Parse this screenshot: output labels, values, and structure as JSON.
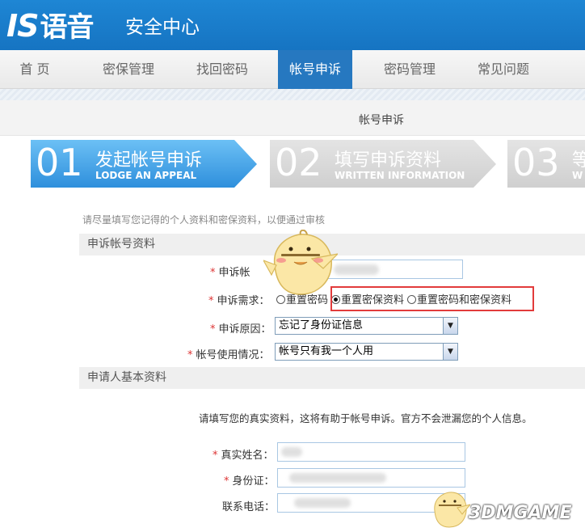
{
  "header": {
    "logo": "IS",
    "logo_cn": "语音",
    "subtitle": "安全中心"
  },
  "nav": {
    "items": [
      {
        "label": "首 页"
      },
      {
        "label": "密保管理"
      },
      {
        "label": "找回密码"
      },
      {
        "label": "帐号申诉",
        "active": true
      },
      {
        "label": "密码管理"
      },
      {
        "label": "常见问题"
      }
    ]
  },
  "page_title": "帐号申诉",
  "steps": [
    {
      "num": "01",
      "title": "发起帐号申诉",
      "en": "LODGE AN APPEAL",
      "state": "current"
    },
    {
      "num": "02",
      "title": "填写申诉资料",
      "en": "WRITTEN INFORMATION",
      "state": "pending"
    },
    {
      "num": "03",
      "title": "等",
      "en": "W",
      "state": "pending"
    }
  ],
  "hint_top": "请尽量填写您记得的个人资料和密保资料，以便通过审核",
  "section1": {
    "title": "申诉帐号资料",
    "account_label": "申诉帐",
    "need_label": "申诉需求：",
    "need_options": [
      "重置密码",
      "重置密保资料",
      "重置密码和密保资料"
    ],
    "need_selected": 1,
    "reason_label": "申诉原因：",
    "reason_value": "忘记了身份证信息",
    "usage_label": "帐号使用情况：",
    "usage_value": "帐号只有我一个人用"
  },
  "section2": {
    "title": "申请人基本资料",
    "note": "请填写您的真实资料，这将有助于帐号申诉。官方不会泄漏您的个人信息。",
    "name_label": "真实姓名：",
    "id_label": "身份证：",
    "phone_label": "联系电话："
  },
  "required_mark": "*",
  "watermark": "3DMGAME",
  "colors": {
    "brand_blue": "#1a7cca",
    "active_step": "#4aa3e8",
    "inactive_step": "#d4d4d4",
    "required": "#dd3333",
    "highlight": "#e23b3b"
  }
}
